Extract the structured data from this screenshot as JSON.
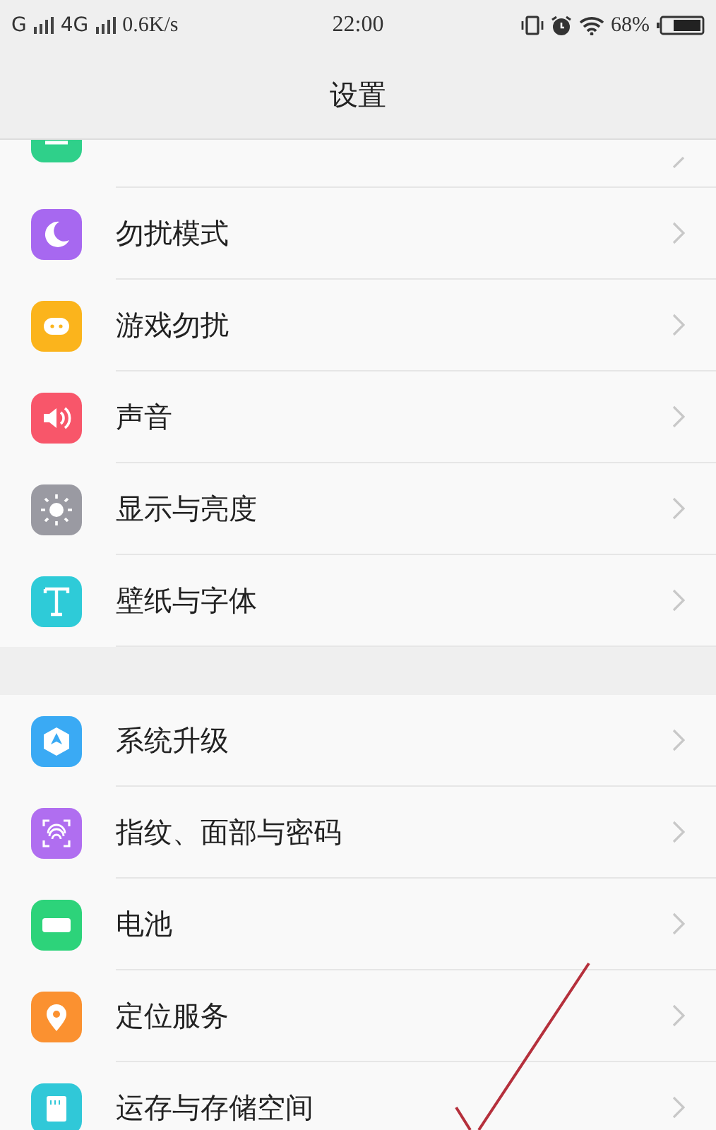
{
  "status_bar": {
    "network_1": "G",
    "network_2": "4G",
    "speed": "0.6K/s",
    "time": "22:00",
    "battery": "68%"
  },
  "header": {
    "title": "设置"
  },
  "cut_row": {
    "kind": "notice",
    "color": "#2fd08a"
  },
  "groups": [
    {
      "items": [
        {
          "label": "勿扰模式",
          "kind": "moon",
          "color": "#a768f0"
        },
        {
          "label": "游戏勿扰",
          "kind": "game",
          "color": "#fbb41c"
        },
        {
          "label": "声音",
          "kind": "sound",
          "color": "#f8566a"
        },
        {
          "label": "显示与亮度",
          "kind": "sun",
          "color": "#9a9aa2"
        },
        {
          "label": "壁纸与字体",
          "kind": "font",
          "color": "#2ecbd8"
        }
      ]
    },
    {
      "items": [
        {
          "label": "系统升级",
          "kind": "update",
          "color": "#3aaaf4"
        },
        {
          "label": "指纹、面部与密码",
          "kind": "finger",
          "color": "#b06ef0"
        },
        {
          "label": "电池",
          "kind": "battery",
          "color": "#2dd37a"
        },
        {
          "label": "定位服务",
          "kind": "pin",
          "color": "#fb9130"
        },
        {
          "label": "运存与存储空间",
          "kind": "card",
          "color": "#30c8d8"
        }
      ]
    }
  ]
}
